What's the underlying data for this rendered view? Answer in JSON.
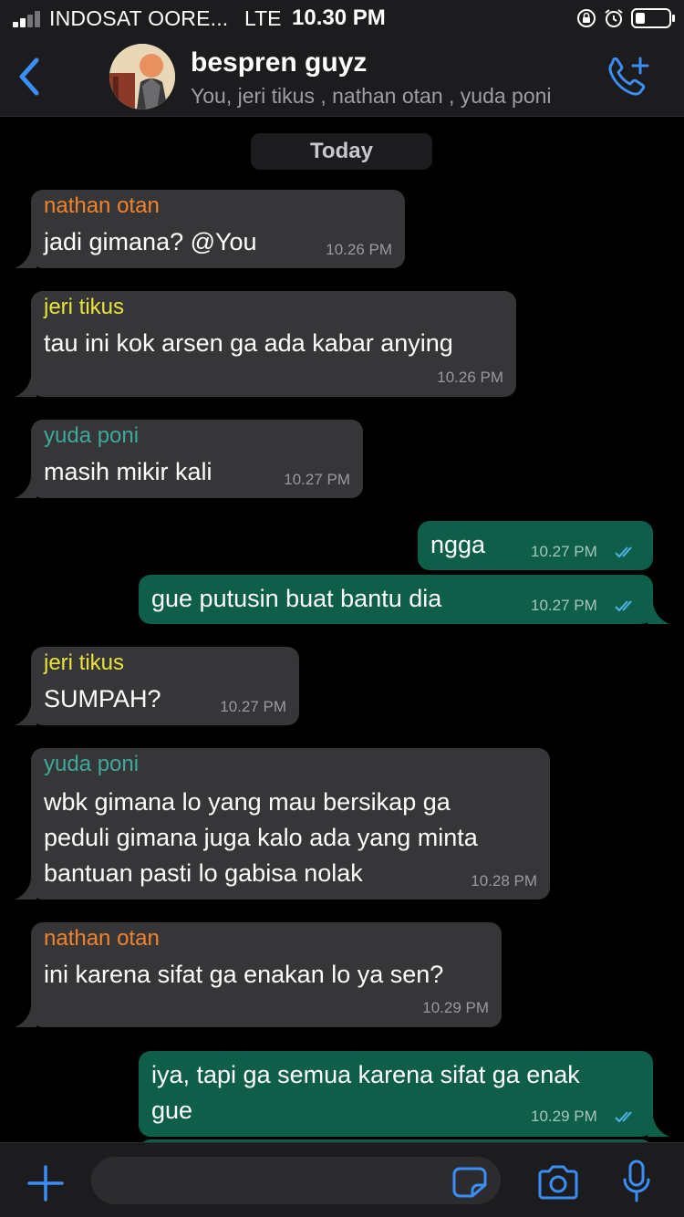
{
  "status_bar": {
    "carrier": "INDOSAT OORE...",
    "network": "LTE",
    "time": "10.30 PM"
  },
  "header": {
    "title": "bespren guyz",
    "members": "You, jeri tikus , nathan otan , yuda poni"
  },
  "chat": {
    "date_label": "Today",
    "messages": [
      {
        "direction": "in",
        "sender": "nathan otan",
        "sender_color": "#f0832b",
        "lines": [
          "jadi gimana? @You"
        ],
        "time": "10.26 PM"
      },
      {
        "direction": "in",
        "sender": "jeri tikus",
        "sender_color": "#e8e43a",
        "lines": [
          "tau ini kok arsen ga ada kabar anying"
        ],
        "time": "10.26 PM"
      },
      {
        "direction": "in",
        "sender": "yuda poni",
        "sender_color": "#3ea99b",
        "lines": [
          "masih mikir kali"
        ],
        "time": "10.27 PM"
      },
      {
        "direction": "out",
        "lines": [
          "ngga"
        ],
        "time": "10.27 PM",
        "read": true
      },
      {
        "direction": "out",
        "lines": [
          "gue putusin buat bantu dia"
        ],
        "time": "10.27 PM",
        "read": true
      },
      {
        "direction": "in",
        "sender": "jeri tikus",
        "sender_color": "#e8e43a",
        "lines": [
          "SUMPAH?"
        ],
        "time": "10.27 PM"
      },
      {
        "direction": "in",
        "sender": "yuda poni",
        "sender_color": "#3ea99b",
        "lines": [
          "wbk gimana lo yang mau bersikap ga",
          "peduli gimana juga kalo ada yang minta",
          "bantuan pasti lo gabisa nolak"
        ],
        "time": "10.28 PM"
      },
      {
        "direction": "in",
        "sender": "nathan otan",
        "sender_color": "#f0832b",
        "lines": [
          "ini karena sifat ga enakan lo ya sen?"
        ],
        "time": "10.29 PM"
      },
      {
        "direction": "out",
        "lines": [
          "iya, tapi ga semua karena sifat ga enak",
          "gue"
        ],
        "time": "10.29 PM",
        "read": true
      }
    ]
  },
  "composer": {
    "placeholder": ""
  },
  "colors": {
    "accent": "#3a8ef6",
    "incoming_bubble": "#363638",
    "outgoing_bubble": "#0e5e4a",
    "read_ticks": "#4fb3e8"
  },
  "icons": {
    "back": "chevron-left-icon",
    "call": "add-call-icon",
    "plus": "plus-icon",
    "sticker": "sticker-icon",
    "camera": "camera-icon",
    "mic": "microphone-icon"
  }
}
